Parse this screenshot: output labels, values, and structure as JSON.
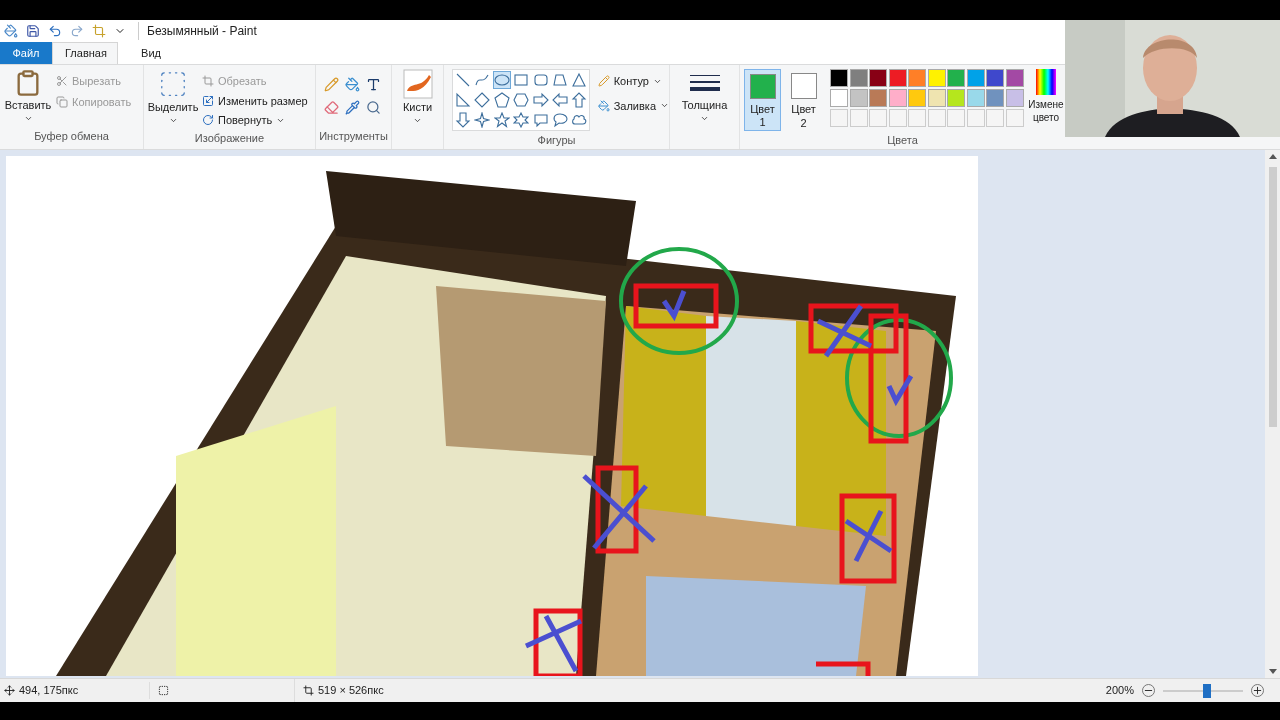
{
  "window": {
    "title": "Безымянный - Paint"
  },
  "tabs": [
    {
      "label": "Файл",
      "kind": "file",
      "selected": false
    },
    {
      "label": "Главная",
      "kind": "tab",
      "selected": true
    },
    {
      "label": "Вид",
      "kind": "tab",
      "selected": false
    }
  ],
  "clipboard": {
    "paste": "Вставить",
    "cut": "Вырезать",
    "copy": "Копировать",
    "group": "Буфер обмена"
  },
  "image": {
    "select": "Выделить",
    "crop": "Обрезать",
    "resize": "Изменить размер",
    "rotate": "Повернуть",
    "group": "Изображение"
  },
  "tools": {
    "group": "Инструменты"
  },
  "brushes": {
    "label": "Кисти"
  },
  "shapes": {
    "group": "Фигуры",
    "outline": "Контур",
    "fill": "Заливка",
    "items": [
      {
        "kind": "line",
        "selected": false
      },
      {
        "kind": "curve",
        "selected": false
      },
      {
        "kind": "ellipse",
        "selected": true
      },
      {
        "kind": "rect",
        "selected": false
      },
      {
        "kind": "roundrect",
        "selected": false
      },
      {
        "kind": "polygon",
        "selected": false
      },
      {
        "kind": "triangle",
        "selected": false
      },
      {
        "kind": "righttriangle",
        "selected": false
      },
      {
        "kind": "diamond",
        "selected": false
      },
      {
        "kind": "pentagon",
        "selected": false
      },
      {
        "kind": "hexagon",
        "selected": false
      },
      {
        "kind": "arrowright",
        "selected": false
      },
      {
        "kind": "arrowleft",
        "selected": false
      },
      {
        "kind": "arrowup",
        "selected": false
      },
      {
        "kind": "arrowdown",
        "selected": false
      },
      {
        "kind": "star4",
        "selected": false
      },
      {
        "kind": "star5",
        "selected": false
      },
      {
        "kind": "star6",
        "selected": false
      },
      {
        "kind": "callout",
        "selected": false
      },
      {
        "kind": "bubble",
        "selected": false
      },
      {
        "kind": "cloud",
        "selected": false
      }
    ]
  },
  "size": {
    "label": "Толщина"
  },
  "colors": {
    "group": "Цвета",
    "color1": {
      "label": "Цвет",
      "index": "1",
      "color": "#22b14c",
      "selected": true
    },
    "color2": {
      "label": "Цвет",
      "index": "2",
      "color": "#ffffff",
      "selected": false
    },
    "palette": [
      {
        "color": "#000000"
      },
      {
        "color": "#7f7f7f"
      },
      {
        "color": "#880015"
      },
      {
        "color": "#ed1c24"
      },
      {
        "color": "#ff7f27"
      },
      {
        "color": "#fff200"
      },
      {
        "color": "#22b14c"
      },
      {
        "color": "#00a2e8"
      },
      {
        "color": "#3f48cc"
      },
      {
        "color": "#a349a4"
      },
      {
        "color": "#ffffff"
      },
      {
        "color": "#c3c3c3"
      },
      {
        "color": "#b97a57"
      },
      {
        "color": "#ffaec9"
      },
      {
        "color": "#ffc90e"
      },
      {
        "color": "#efe4b0"
      },
      {
        "color": "#b5e61d"
      },
      {
        "color": "#99d9ea"
      },
      {
        "color": "#7092be"
      },
      {
        "color": "#c8bfe7"
      }
    ],
    "edit": "Измене цвето"
  },
  "status_bar": {
    "position": "494, 175пкс",
    "size": "519 × 526пкс",
    "zoom": "200%",
    "level": 0.55
  }
}
